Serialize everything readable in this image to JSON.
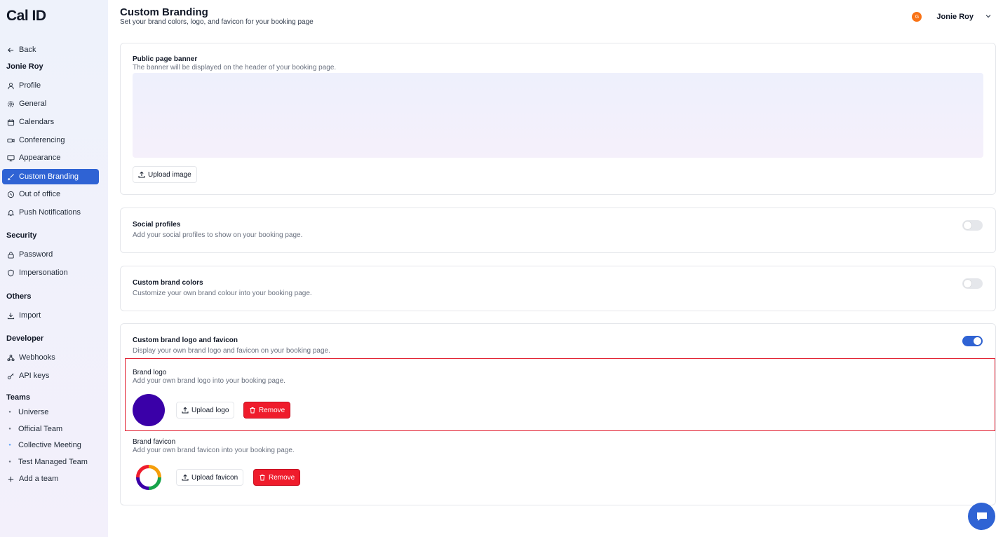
{
  "app": {
    "logo": "Cal ID"
  },
  "sidebar": {
    "back": "Back",
    "user_section": "Jonie Roy",
    "items": [
      {
        "label": "Profile",
        "icon": "user-icon"
      },
      {
        "label": "General",
        "icon": "gear-icon"
      },
      {
        "label": "Calendars",
        "icon": "calendar-icon"
      },
      {
        "label": "Conferencing",
        "icon": "video-icon"
      },
      {
        "label": "Appearance",
        "icon": "monitor-icon"
      },
      {
        "label": "Custom Branding",
        "icon": "brush-icon",
        "active": true
      },
      {
        "label": "Out of office",
        "icon": "clock-icon"
      },
      {
        "label": "Push Notifications",
        "icon": "bell-icon"
      }
    ],
    "security": {
      "heading": "Security",
      "items": [
        "Password",
        "Impersonation"
      ]
    },
    "others": {
      "heading": "Others",
      "items": [
        "Import"
      ]
    },
    "developer": {
      "heading": "Developer",
      "items": [
        "Webhooks",
        "API keys"
      ]
    },
    "teams": {
      "heading": "Teams",
      "items": [
        "Universe",
        "Official Team",
        "Collective Meeting",
        "Test Managed Team"
      ],
      "add": "Add a team"
    }
  },
  "header": {
    "title": "Custom Branding",
    "subtitle": "Set your brand colors, logo, and favicon for your booking page",
    "user": {
      "initial": "G",
      "name": "Jonie Roy"
    }
  },
  "banner_card": {
    "title": "Public page banner",
    "desc": "The banner will be displayed on the header of your booking page.",
    "upload_label": "Upload image"
  },
  "social_card": {
    "title": "Social profiles",
    "desc": "Add your social profiles to show on your booking page.",
    "enabled": false
  },
  "colors_card": {
    "title": "Custom brand colors",
    "desc": "Customize your own brand colour into your booking page.",
    "enabled": false
  },
  "logo_card": {
    "title": "Custom brand logo and favicon",
    "desc": "Display your own brand logo and favicon on your booking page.",
    "enabled": true,
    "brand_logo": {
      "title": "Brand logo",
      "desc": "Add your own brand logo into your booking page.",
      "upload_label": "Upload logo",
      "remove_label": "Remove"
    },
    "brand_favicon": {
      "title": "Brand favicon",
      "desc": "Add your own brand favicon into your booking page.",
      "upload_label": "Upload favicon",
      "remove_label": "Remove"
    }
  },
  "colors": {
    "accent": "#2f63d4",
    "danger": "#ef1c2c",
    "brand_logo": "#3a00a8",
    "highlight": "#e11d2e"
  }
}
